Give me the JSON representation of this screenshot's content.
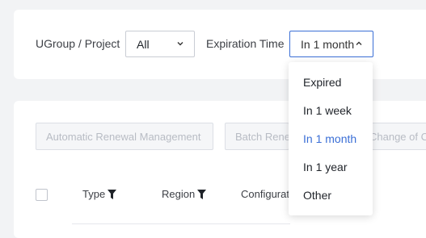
{
  "filters": {
    "ugroup_label": "UGroup / Project",
    "ugroup_value": "All",
    "expiration_label": "Expiration Time",
    "expiration_value": "In 1 month"
  },
  "dropdown": {
    "options": [
      "Expired",
      "In 1 week",
      "In 1 month",
      "In 1 year",
      "Other"
    ],
    "selected": "In 1 month"
  },
  "toolbar": {
    "auto_renewal_label": "Automatic Renewal Management",
    "batch_label": "Batch Rene",
    "change_label": "Change of C"
  },
  "table": {
    "columns": [
      "Type",
      "Region",
      "Configurati"
    ]
  },
  "colors": {
    "accent": "#3b6fd6",
    "disabled_text": "#b8bcc4"
  },
  "icons": {
    "chevron_down": "chevron-down-icon",
    "chevron_up": "chevron-up-icon",
    "filter": "filter-icon"
  }
}
